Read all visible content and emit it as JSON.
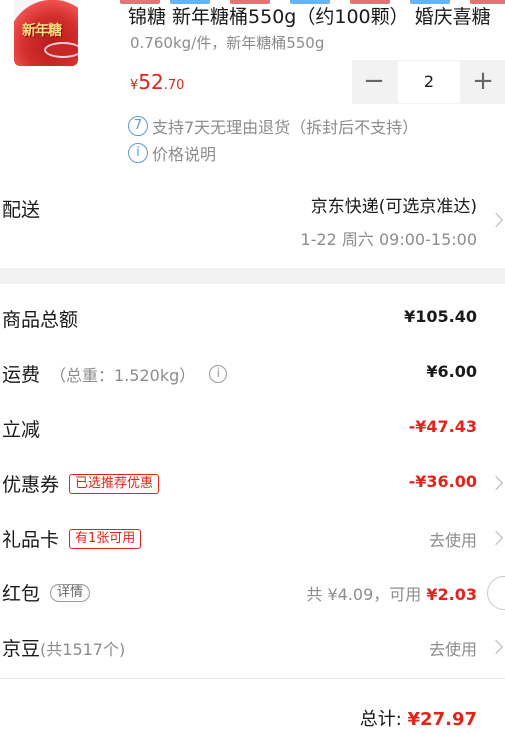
{
  "product": {
    "image_tag": "新年糖",
    "title": "锦糖 新年糖桶550g（约100颗） 婚庆喜糖",
    "spec": "0.760kg/件，新年糖桶550g",
    "price_currency": "¥",
    "price_int": "52",
    "price_dec": ".70",
    "quantity": "2",
    "minus_icon": "−",
    "plus_icon": "+",
    "return_policy_icon": "7",
    "return_policy": "支持7天无理由退货（拆封后不支持）",
    "price_info_icon": "i",
    "price_info": "价格说明"
  },
  "delivery": {
    "label": "配送",
    "method": "京东快递(可选京准达)",
    "time": "1-22 周六 09:00-15:00"
  },
  "summary": {
    "goods_total_label": "商品总额",
    "goods_total_value": "¥105.40",
    "shipping_label": "运费",
    "shipping_weight": "（总重：1.520kg）",
    "shipping_info_icon": "i",
    "shipping_value": "¥6.00",
    "discount_label": "立减",
    "discount_value": "-¥47.43",
    "coupon_label": "优惠券",
    "coupon_badge": "已选推荐优惠",
    "coupon_value": "-¥36.00",
    "giftcard_label": "礼品卡",
    "giftcard_badge": "有1张可用",
    "giftcard_action": "去使用",
    "redpacket_label": "红包",
    "redpacket_badge": "详情",
    "redpacket_total_prefix": "共 ¥4.09，可用",
    "redpacket_available": "¥2.03",
    "jingdou_label": "京豆",
    "jingdou_count": "(共1517个)",
    "jingdou_action": "去使用",
    "total_label": "总计:",
    "total_value": "¥27.97"
  },
  "colors": {
    "accent_red": "#e2231a",
    "muted_text": "#8c8c8c",
    "info_blue": "#5b9bd5"
  }
}
